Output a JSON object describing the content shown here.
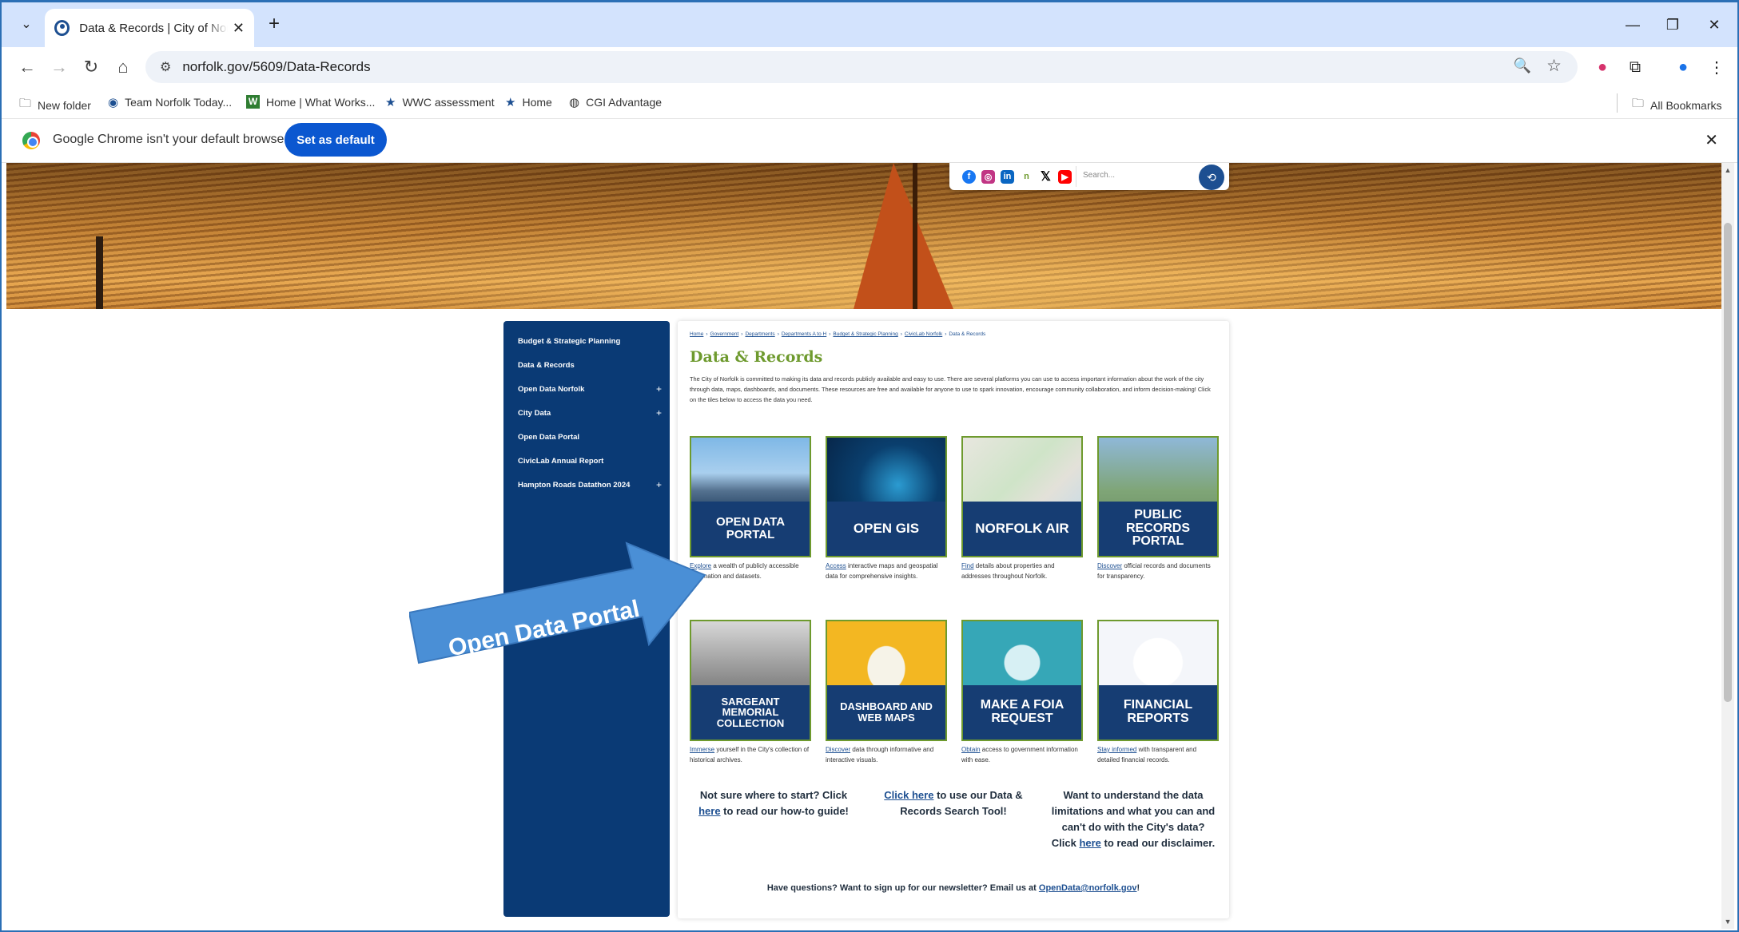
{
  "browser": {
    "tab_title": "Data & Records | City of Norfolk",
    "url": "norfolk.gov/5609/Data-Records",
    "bookmarks": [
      {
        "label": "New folder",
        "icon": "folder-icon"
      },
      {
        "label": "Team Norfolk Today...",
        "icon": "norfolk-icon"
      },
      {
        "label": "Home | What Works...",
        "icon": "w-icon"
      },
      {
        "label": "WWC assessment",
        "icon": "star-icon"
      },
      {
        "label": "Home",
        "icon": "star-icon"
      },
      {
        "label": "CGI Advantage",
        "icon": "globe-icon"
      }
    ],
    "all_bookmarks": "All Bookmarks",
    "infobar_text": "Google Chrome isn't your default browser",
    "set_default_label": "Set as default"
  },
  "site": {
    "search_placeholder": "Search...",
    "sidebar": [
      {
        "label": "Budget & Strategic Planning",
        "expand": ""
      },
      {
        "label": "Data & Records",
        "expand": ""
      },
      {
        "label": "Open Data Norfolk",
        "expand": "+"
      },
      {
        "label": "City Data",
        "expand": "+"
      },
      {
        "label": "Open Data Portal",
        "expand": ""
      },
      {
        "label": "CivicLab Annual Report",
        "expand": ""
      },
      {
        "label": "Hampton Roads Datathon 2024",
        "expand": "+"
      }
    ],
    "breadcrumbs": [
      "Home",
      "Government",
      "Departments",
      "Departments A to H",
      "Budget & Strategic Planning",
      "CivicLab Norfolk",
      "Data & Records"
    ],
    "page_title": "Data & Records",
    "intro": "The City of Norfolk is committed to making its data and records publicly available and easy to use. There are several platforms you can use to access important information about the work of the city through data, maps, dashboards, and documents. These resources are free and available for anyone to use to spark innovation, encourage community collaboration, and inform decision-making! Click on the tiles below to access the data you need.",
    "tiles": [
      {
        "label": "OPEN DATA PORTAL",
        "link": "Explore",
        "desc": " a wealth of publicly accessible information and datasets."
      },
      {
        "label": "OPEN GIS",
        "link": "Access",
        "desc": " interactive maps and geospatial data for comprehensive insights."
      },
      {
        "label": "NORFOLK AIR",
        "link": "Find",
        "desc": " details about properties and addresses throughout Norfolk."
      },
      {
        "label": "PUBLIC RECORDS PORTAL",
        "link": "Discover",
        "desc": " official records and documents for transparency."
      },
      {
        "label": "SARGEANT MEMORIAL COLLECTION",
        "link": "Immerse",
        "desc": " yourself in the City's collection of historical archives."
      },
      {
        "label": "DASHBOARD AND WEB MAPS",
        "link": "Discover",
        "desc": " data through informative and interactive visuals."
      },
      {
        "label": "MAKE A FOIA REQUEST",
        "link": "Obtain",
        "desc": " access to government information with ease."
      },
      {
        "label": "FINANCIAL REPORTS",
        "link": "Stay informed",
        "desc": " with transparent and detailed financial records."
      }
    ],
    "help": {
      "guide_pre": "Not sure where to start? Click ",
      "guide_link": "here",
      "guide_post": " to read our how-to guide!",
      "search_link": "Click here",
      "search_post": " to use our Data & Records Search Tool!",
      "limits_pre": "Want to understand the data limitations and what you can and can't do with the City's data? Click ",
      "limits_link": "here",
      "limits_post": " to read our disclaimer."
    },
    "newsletter_pre": "Have questions? Want to sign up for our newsletter? Email us at ",
    "newsletter_email": "OpenData@norfolk.gov",
    "newsletter_post": "!"
  },
  "annotation": {
    "arrow_text": "Open Data Portal",
    "arrow_color": "#4a8fd6"
  }
}
